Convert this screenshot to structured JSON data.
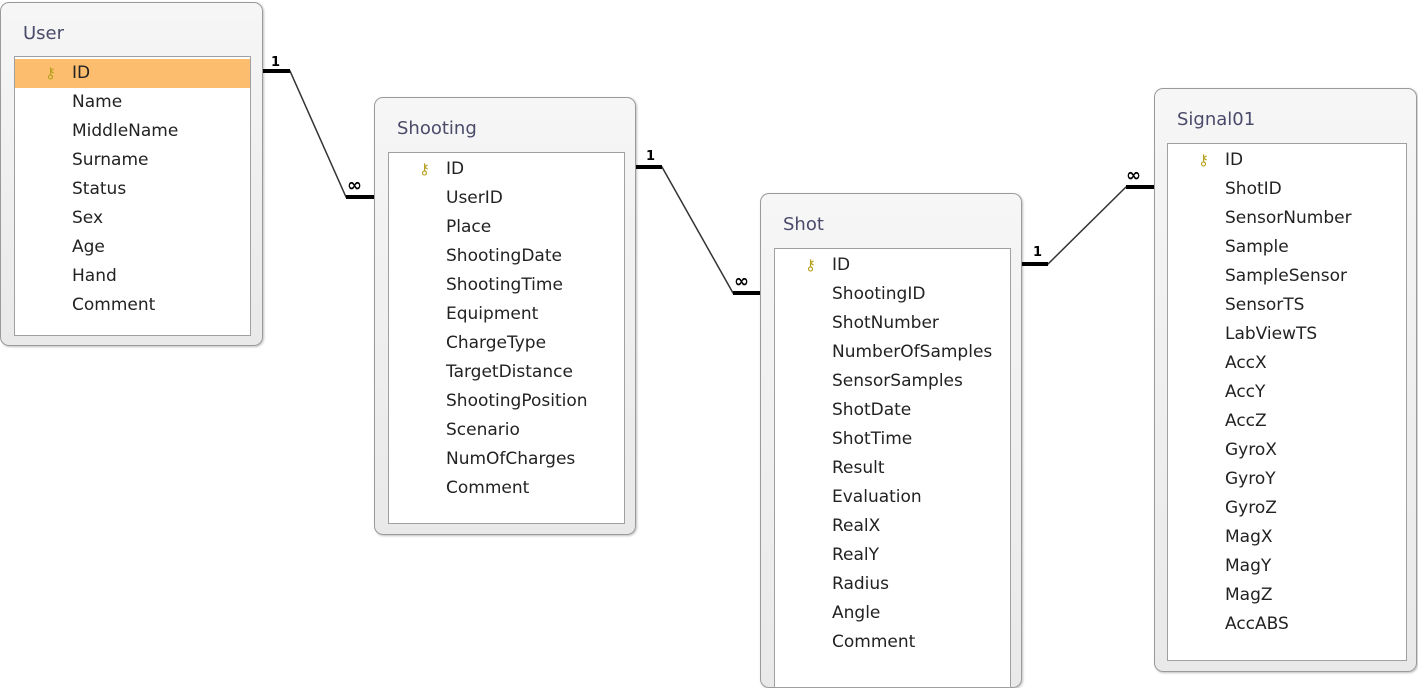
{
  "tables": [
    {
      "name": "User",
      "fields": [
        "ID",
        "Name",
        "MiddleName",
        "Surname",
        "Status",
        "Sex",
        "Age",
        "Hand",
        "Comment"
      ],
      "primary_key": "ID",
      "selected": "ID"
    },
    {
      "name": "Shooting",
      "fields": [
        "ID",
        "UserID",
        "Place",
        "ShootingDate",
        "ShootingTime",
        "Equipment",
        "ChargeType",
        "TargetDistance",
        "ShootingPosition",
        "Scenario",
        "NumOfCharges",
        "Comment"
      ],
      "primary_key": "ID"
    },
    {
      "name": "Shot",
      "fields": [
        "ID",
        "ShootingID",
        "ShotNumber",
        "NumberOfSamples",
        "SensorSamples",
        "ShotDate",
        "ShotTime",
        "Result",
        "Evaluation",
        "RealX",
        "RealY",
        "Radius",
        "Angle",
        "Comment"
      ],
      "primary_key": "ID"
    },
    {
      "name": "Signal01",
      "fields": [
        "ID",
        "ShotID",
        "SensorNumber",
        "Sample",
        "SampleSensor",
        "SensorTS",
        "LabViewTS",
        "AccX",
        "AccY",
        "AccZ",
        "GyroX",
        "GyroY",
        "GyroZ",
        "MagX",
        "MagY",
        "MagZ",
        "AccABS"
      ],
      "primary_key": "ID"
    }
  ],
  "relationships": [
    {
      "from": "User.ID",
      "to": "Shooting.UserID",
      "one": "1",
      "many": "∞"
    },
    {
      "from": "Shooting.ID",
      "to": "Shot.ShootingID",
      "one": "1",
      "many": "∞"
    },
    {
      "from": "Shot.ID",
      "to": "Signal01.ShotID",
      "one": "1",
      "many": "∞"
    }
  ],
  "colors": {
    "selected_row": "#fdbd6e",
    "key_icon": "#b8a020"
  }
}
